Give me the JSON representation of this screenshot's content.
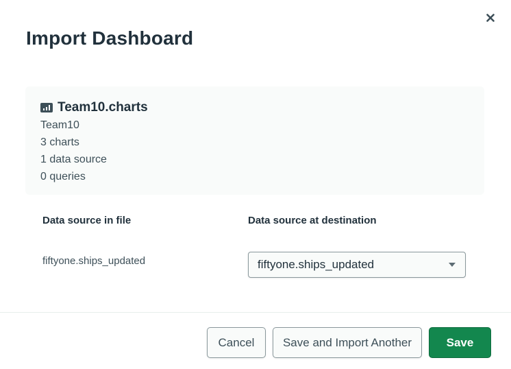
{
  "dialog": {
    "title": "Import Dashboard",
    "close_icon": "close-icon"
  },
  "summary": {
    "icon": "bar-chart-icon",
    "file_name": "Team10.charts",
    "dashboard_name": "Team10",
    "charts_count": "3 charts",
    "data_sources_count": "1 data source",
    "queries_count": "0 queries"
  },
  "mapping": {
    "col_file_label": "Data source in file",
    "col_destination_label": "Data source at destination",
    "rows": [
      {
        "source": "fiftyone.ships_updated",
        "destination": "fiftyone.ships_updated"
      }
    ]
  },
  "footer": {
    "cancel_label": "Cancel",
    "save_import_another_label": "Save and Import Another",
    "save_label": "Save"
  },
  "colors": {
    "primary": "#13874e",
    "text": "#21313c",
    "card_bg": "#f9fbfa"
  }
}
